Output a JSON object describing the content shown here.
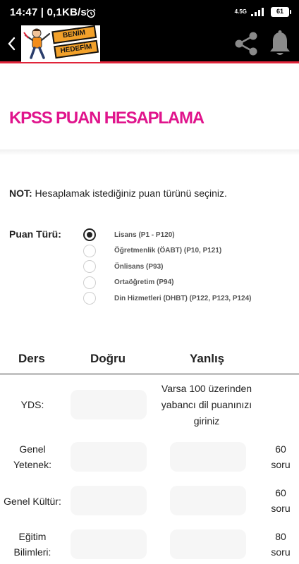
{
  "status_bar": {
    "time_speed": "14:47 | 0,1KB/s",
    "network": "4.5G",
    "battery": "61"
  },
  "app_bar": {
    "logo_line1": "BENİM",
    "logo_line2": "HEDEFİM"
  },
  "page": {
    "title": "KPSS PUAN HESAPLAMA"
  },
  "note": {
    "bold": "NOT:",
    "text": " Hesaplamak istediğiniz puan türünü seçiniz."
  },
  "puan_turu": {
    "label": "Puan Türü:",
    "options": [
      {
        "label": "Lisans (P1 - P120)",
        "checked": true
      },
      {
        "label": "Öğretmenlik (ÖABT) (P10, P121)",
        "checked": false
      },
      {
        "label": "Önlisans (P93)",
        "checked": false
      },
      {
        "label": "Ortaöğretim (P94)",
        "checked": false
      },
      {
        "label": "Din Hizmetleri (DHBT) (P122, P123, P124)",
        "checked": false
      }
    ]
  },
  "table": {
    "headers": {
      "ders": "Ders",
      "dogru": "Doğru",
      "yanlis": "Yanlış"
    },
    "rows": [
      {
        "label": "YDS:",
        "note": "Varsa 100 üzerinden yabancı dil puanınızı giriniz"
      },
      {
        "label": "Genel Yetenek:",
        "soru": "60 soru"
      },
      {
        "label": "Genel Kültür:",
        "soru": "60 soru"
      },
      {
        "label": "Eğitim Bilimleri:",
        "soru": "80 soru"
      }
    ]
  }
}
